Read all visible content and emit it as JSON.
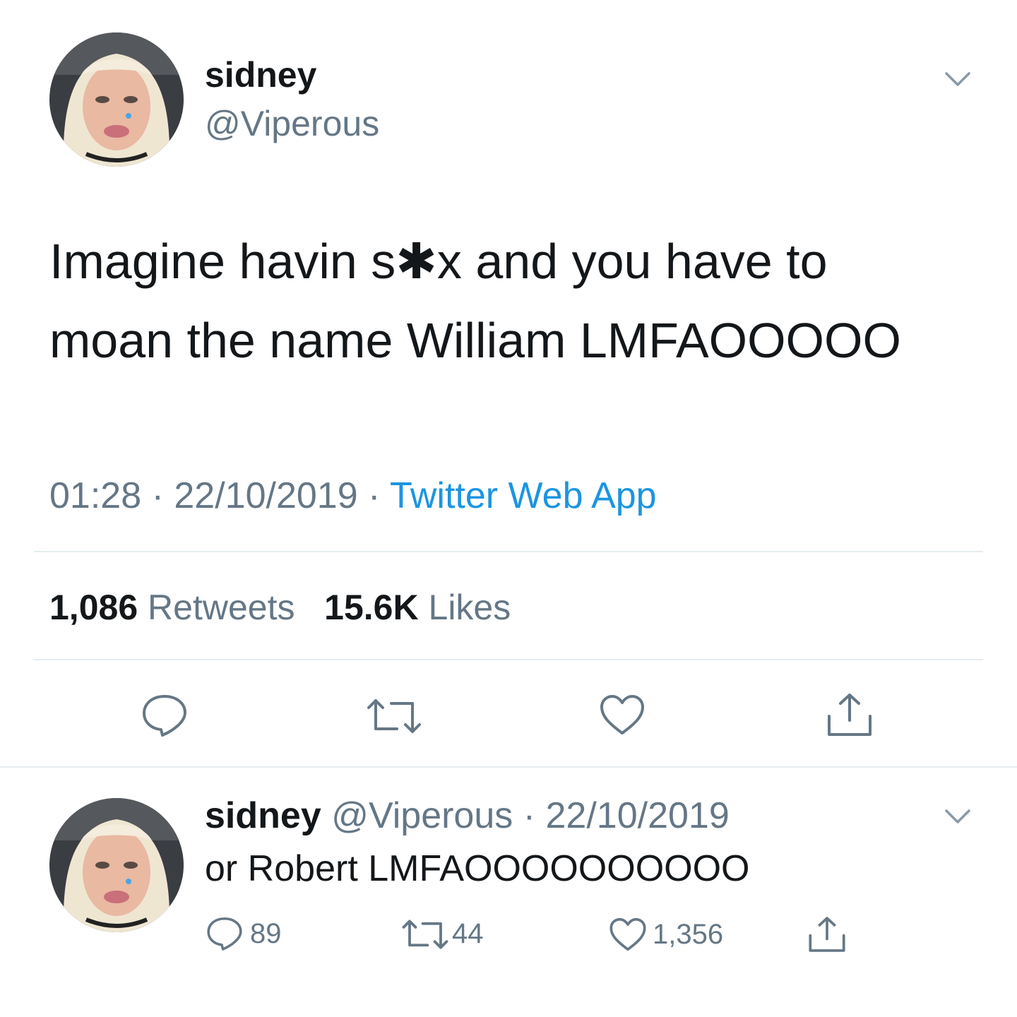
{
  "tweet": {
    "author": {
      "display_name": "sidney",
      "handle": "@Viperous"
    },
    "body_line1": "Imagine havin s✱x and you have to",
    "body_line2": "moan the name William LMFAOOOOO",
    "time": "01:28",
    "date": "22/10/2019",
    "separator": "·",
    "source": "Twitter Web App",
    "retweets_count": "1,086",
    "retweets_label": "Retweets",
    "likes_count": "15.6K",
    "likes_label": "Likes"
  },
  "reply": {
    "author": {
      "display_name": "sidney",
      "handle": "@Viperous"
    },
    "date": "· 22/10/2019",
    "text": "or Robert LMFAOOOOOOOOOO",
    "reply_count": "89",
    "retweet_count": "44",
    "like_count": "1,356"
  },
  "colors": {
    "link": "#1b95e0",
    "muted": "#657786",
    "icon": "#657786",
    "divider": "#e6ecf0"
  },
  "icons": [
    "chevron-down-icon",
    "reply-icon",
    "retweet-icon",
    "heart-icon",
    "share-icon"
  ]
}
